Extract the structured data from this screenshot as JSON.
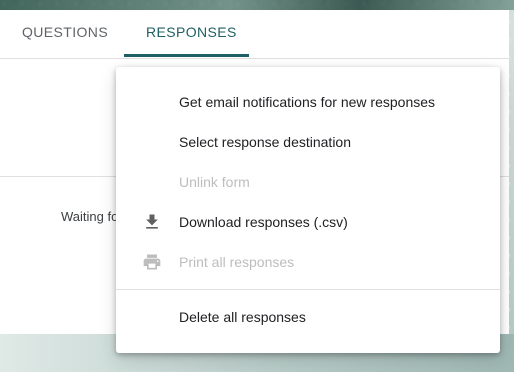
{
  "tabs": {
    "questions": "QUESTIONS",
    "responses": "RESPONSES"
  },
  "content": {
    "waiting_text": "Waiting for responses"
  },
  "menu": {
    "items": [
      {
        "label": "Get email notifications for new responses",
        "enabled": true,
        "icon": null
      },
      {
        "label": "Select response destination",
        "enabled": true,
        "icon": null
      },
      {
        "label": "Unlink form",
        "enabled": false,
        "icon": null
      },
      {
        "label": "Download responses (.csv)",
        "enabled": true,
        "icon": "download-icon"
      },
      {
        "label": "Print all responses",
        "enabled": false,
        "icon": "print-icon"
      },
      {
        "label": "Delete all responses",
        "enabled": true,
        "icon": null
      }
    ]
  },
  "colors": {
    "accent": "#1e5f63",
    "disabled_text": "#bdbdbd",
    "text": "#202124"
  }
}
